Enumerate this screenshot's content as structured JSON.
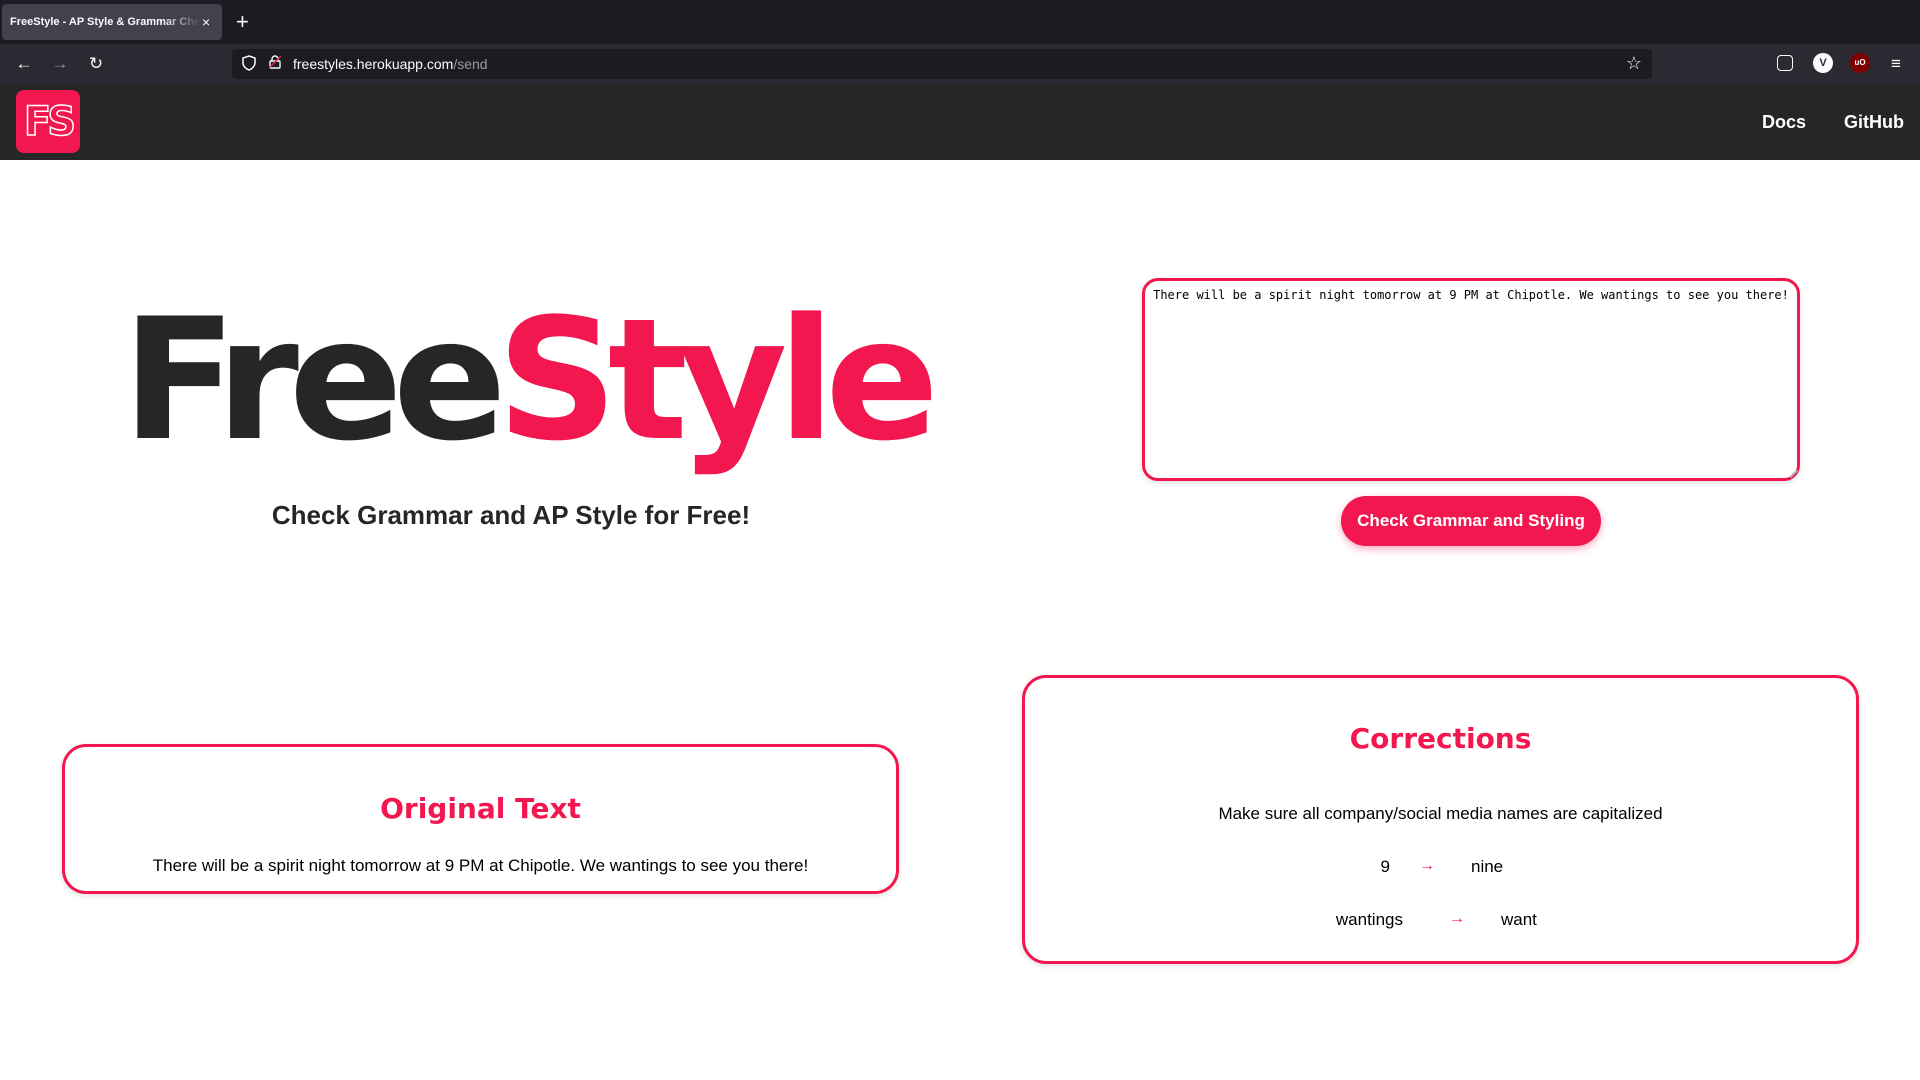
{
  "browser": {
    "tab_title": "FreeStyle - AP Style & Grammar Checker",
    "tab_close": "×",
    "new_tab": "+",
    "url_domain": "freestyles.herokuapp.com",
    "url_path": "/send",
    "back": "←",
    "forward": "→",
    "reload": "↻"
  },
  "site": {
    "logo": "FS",
    "nav": {
      "docs": "Docs",
      "github": "GitHub"
    }
  },
  "hero": {
    "title_part1": "Free",
    "title_part2": "Style",
    "subtitle": "Check Grammar and AP Style for Free!"
  },
  "form": {
    "input_value": "There will be a spirit night tomorrow at 9 PM at Chipotle. We wantings to see you there!",
    "submit_label": "Check Grammar and Styling"
  },
  "original": {
    "title": "Original Text",
    "text": "There will be a spirit night tomorrow at 9 PM at Chipotle. We wantings to see you there!"
  },
  "corrections": {
    "title": "Corrections",
    "note": "Make sure all company/social media names are capitalized",
    "arrow": "→",
    "items": [
      {
        "from": "9",
        "to": "nine"
      },
      {
        "from": "wantings",
        "to": "want"
      }
    ]
  },
  "colors": {
    "accent": "#f2184f",
    "dark": "#262626"
  }
}
